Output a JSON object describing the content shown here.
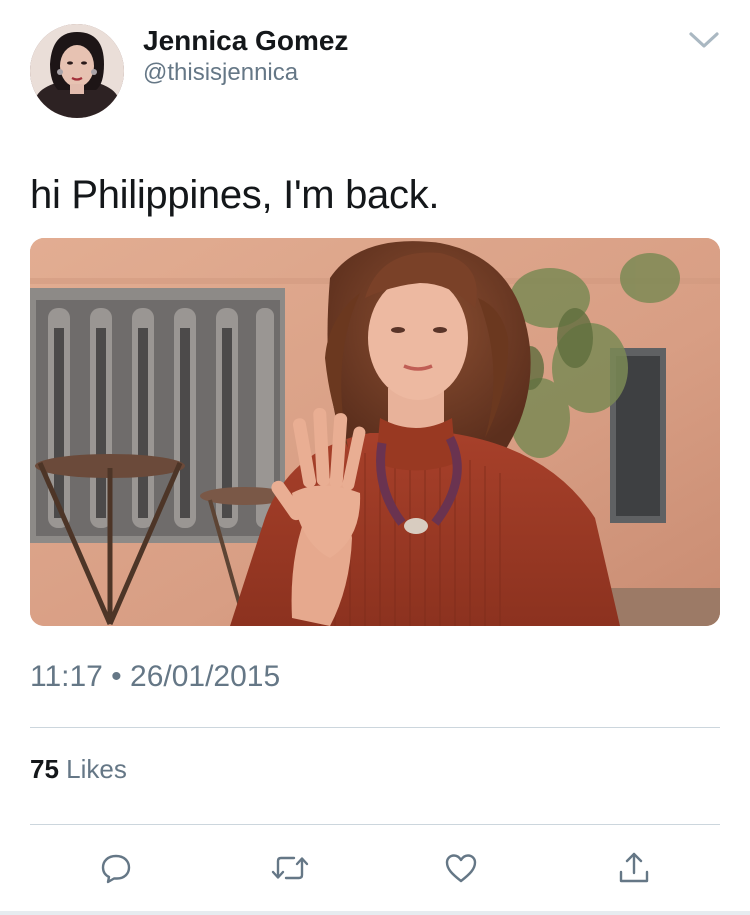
{
  "tweet": {
    "author_name": "Jennica Gomez",
    "author_handle": "@thisisjennica",
    "text": "hi Philippines, I'm back.",
    "timestamp": "11:17 • 26/01/2015",
    "likes_count": "75",
    "likes_label": "Likes"
  },
  "icons": {
    "menu": "chevron-down-icon",
    "reply": "reply-icon",
    "retweet": "retweet-icon",
    "like": "heart-icon",
    "share": "share-icon"
  },
  "colors": {
    "text_primary": "#14171a",
    "text_secondary": "#657786",
    "divider": "#ccd6dd"
  }
}
